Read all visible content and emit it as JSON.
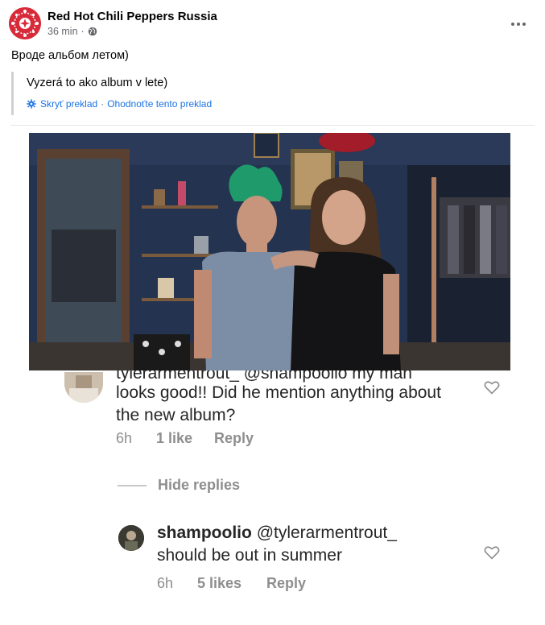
{
  "post": {
    "page_name": "Red Hot Chili Peppers Russia",
    "time": "36 min",
    "separator": "·",
    "original_text": "Вроде альбом летом)",
    "translation": {
      "text": "Vyzerá to ako album v lete)",
      "hide_label": "Skryť preklad",
      "separator": "·",
      "rate_label": "Ohodnoťte tento preklad"
    }
  },
  "instagram": {
    "comment1": {
      "cut_line": "tylerarmentrout_ @shampoolio my man",
      "text": "looks good!! Did he mention anything about the new album?",
      "time": "6h",
      "likes": "1 like",
      "reply": "Reply"
    },
    "hide_replies": "Hide replies",
    "comment2": {
      "username": "shampoolio",
      "mention": "@tylerarmentrout_",
      "text": "should be out in summer",
      "time": "6h",
      "likes": "5 likes",
      "reply": "Reply"
    }
  },
  "icons": {
    "privacy": "globe-icon",
    "translate": "gear-icon",
    "more": "more-options-icon",
    "like": "heart-icon"
  },
  "colors": {
    "link": "#1b74e4",
    "secondary_text": "#65676b",
    "avatar_red": "#d82b3a",
    "ig_gray": "#8e8e8e"
  }
}
